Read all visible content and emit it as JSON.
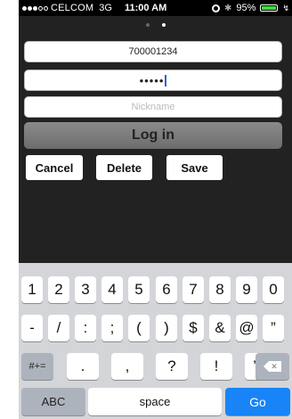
{
  "status_bar": {
    "carrier": "CELCOM",
    "network": "3G",
    "time": "11:00 AM",
    "battery": "95%",
    "battery_level": 0.95,
    "signal_bars": 3
  },
  "form": {
    "id_value": "700001234",
    "password_value": "•••••",
    "nickname_placeholder": "Nickname",
    "login_label": "Log in",
    "cancel_label": "Cancel",
    "delete_label": "Delete",
    "save_label": "Save"
  },
  "keyboard": {
    "row_numbers": [
      "1",
      "2",
      "3",
      "4",
      "5",
      "6",
      "7",
      "8",
      "9",
      "0"
    ],
    "row_symbols": [
      "-",
      "/",
      ":",
      ";",
      "(",
      ")",
      "$",
      "&",
      "@",
      "”"
    ],
    "shift_label": "#+=",
    "row_punct": [
      ".",
      ",",
      "?",
      "!",
      "’"
    ],
    "abc_label": "ABC",
    "space_label": "space",
    "go_label": "Go"
  },
  "colors": {
    "accent": "#1884f7",
    "battery": "#3ddc3d",
    "caret": "#2a62d9"
  }
}
